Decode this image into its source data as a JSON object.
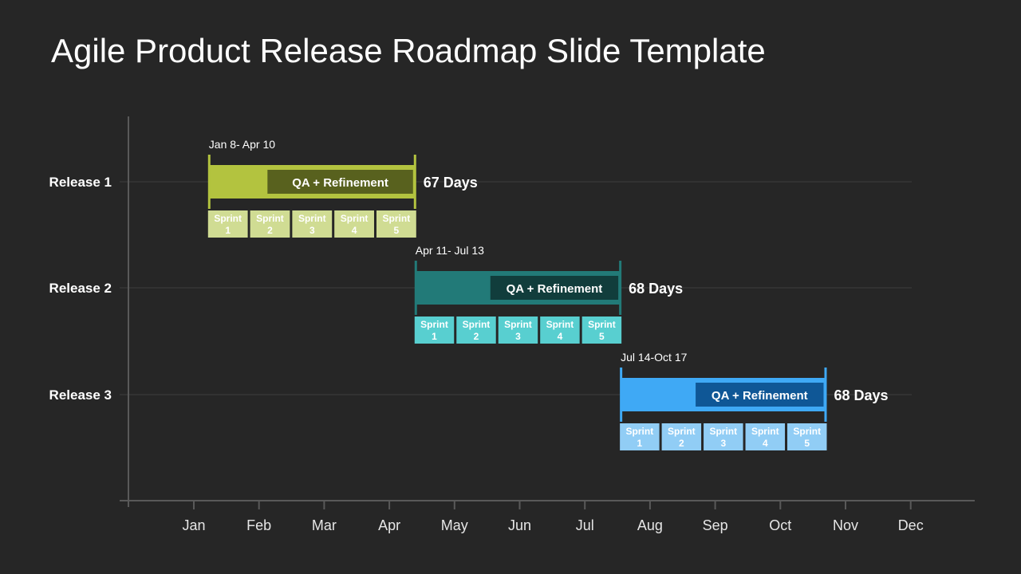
{
  "slide": {
    "title": "Agile Product Release Roadmap Slide Template"
  },
  "chart_data": {
    "type": "gantt",
    "title": "Agile Product Release Roadmap Slide Template",
    "xlabel": "",
    "ylabel": "",
    "x_ticks": [
      "Jan",
      "Feb",
      "Mar",
      "Apr",
      "May",
      "Jun",
      "Jul",
      "Aug",
      "Sep",
      "Oct",
      "Nov",
      "Dec"
    ],
    "x_range_months": [
      0,
      12
    ],
    "grid": true,
    "releases": [
      {
        "name": "Release 1",
        "range_label": "Jan 8- Apr 10",
        "start_month": 0.23,
        "end_month": 3.4,
        "qa_start_month": 1.13,
        "qa_label": "QA + Refinement",
        "duration_label": "67 Days",
        "color": "#b3c33f",
        "qa_color": "#58611e",
        "sprint_color": "#d0dc93",
        "sprints": [
          {
            "line1": "Sprint",
            "line2": "1"
          },
          {
            "line1": "Sprint",
            "line2": "2"
          },
          {
            "line1": "Sprint",
            "line2": "3"
          },
          {
            "line1": "Sprint",
            "line2": "4"
          },
          {
            "line1": "Sprint",
            "line2": "5"
          }
        ]
      },
      {
        "name": "Release 2",
        "range_label": "Apr 11- Jul 13",
        "start_month": 3.4,
        "end_month": 6.55,
        "qa_start_month": 4.55,
        "qa_label": "QA + Refinement",
        "duration_label": "68 Days",
        "color": "#227a78",
        "qa_color": "#113d3c",
        "sprint_color": "#58cfd0",
        "sprints": [
          {
            "line1": "Sprint",
            "line2": "1"
          },
          {
            "line1": "Sprint",
            "line2": "2"
          },
          {
            "line1": "Sprint",
            "line2": "3"
          },
          {
            "line1": "Sprint",
            "line2": "4"
          },
          {
            "line1": "Sprint",
            "line2": "5"
          }
        ]
      },
      {
        "name": "Release 3",
        "range_label": "Jul 14-Oct 17",
        "start_month": 6.55,
        "end_month": 9.7,
        "qa_start_month": 7.7,
        "qa_label": "QA + Refinement",
        "duration_label": "68 Days",
        "color": "#3fa9f5",
        "qa_color": "#0f5796",
        "sprint_color": "#91cdf5",
        "sprints": [
          {
            "line1": "Sprint",
            "line2": "1"
          },
          {
            "line1": "Sprint",
            "line2": "2"
          },
          {
            "line1": "Sprint",
            "line2": "3"
          },
          {
            "line1": "Sprint",
            "line2": "4"
          },
          {
            "line1": "Sprint",
            "line2": "5"
          }
        ]
      }
    ]
  }
}
